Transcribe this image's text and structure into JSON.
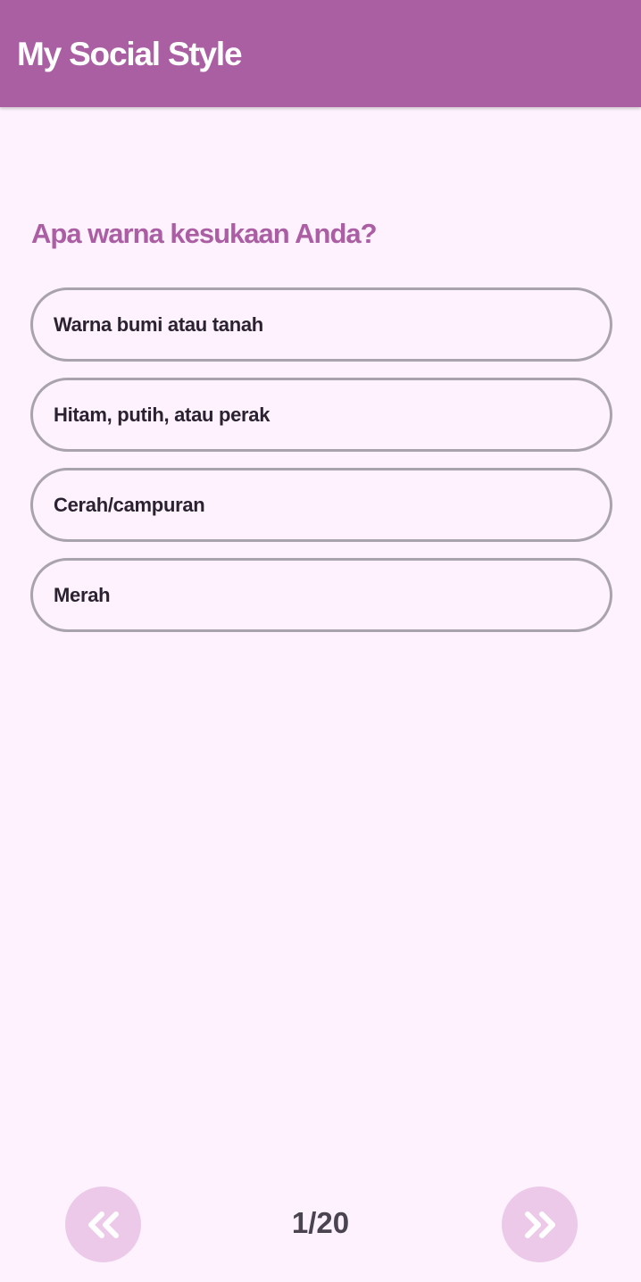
{
  "app": {
    "title": "My Social Style"
  },
  "question": {
    "text": "Apa warna kesukaan Anda?",
    "options": [
      {
        "label": "Warna bumi atau tanah"
      },
      {
        "label": "Hitam, putih, atau perak"
      },
      {
        "label": "Cerah/campuran"
      },
      {
        "label": "Merah"
      }
    ]
  },
  "navigation": {
    "page_indicator": "1/20",
    "prev_icon": "double-chevron-left-icon",
    "next_icon": "double-chevron-right-icon"
  },
  "colors": {
    "app_bar": "#ab5fa3",
    "background": "#fdf2fd",
    "question_text": "#ac5ea4",
    "option_border": "#a9a3ad",
    "nav_button": "#ecc9e8"
  }
}
